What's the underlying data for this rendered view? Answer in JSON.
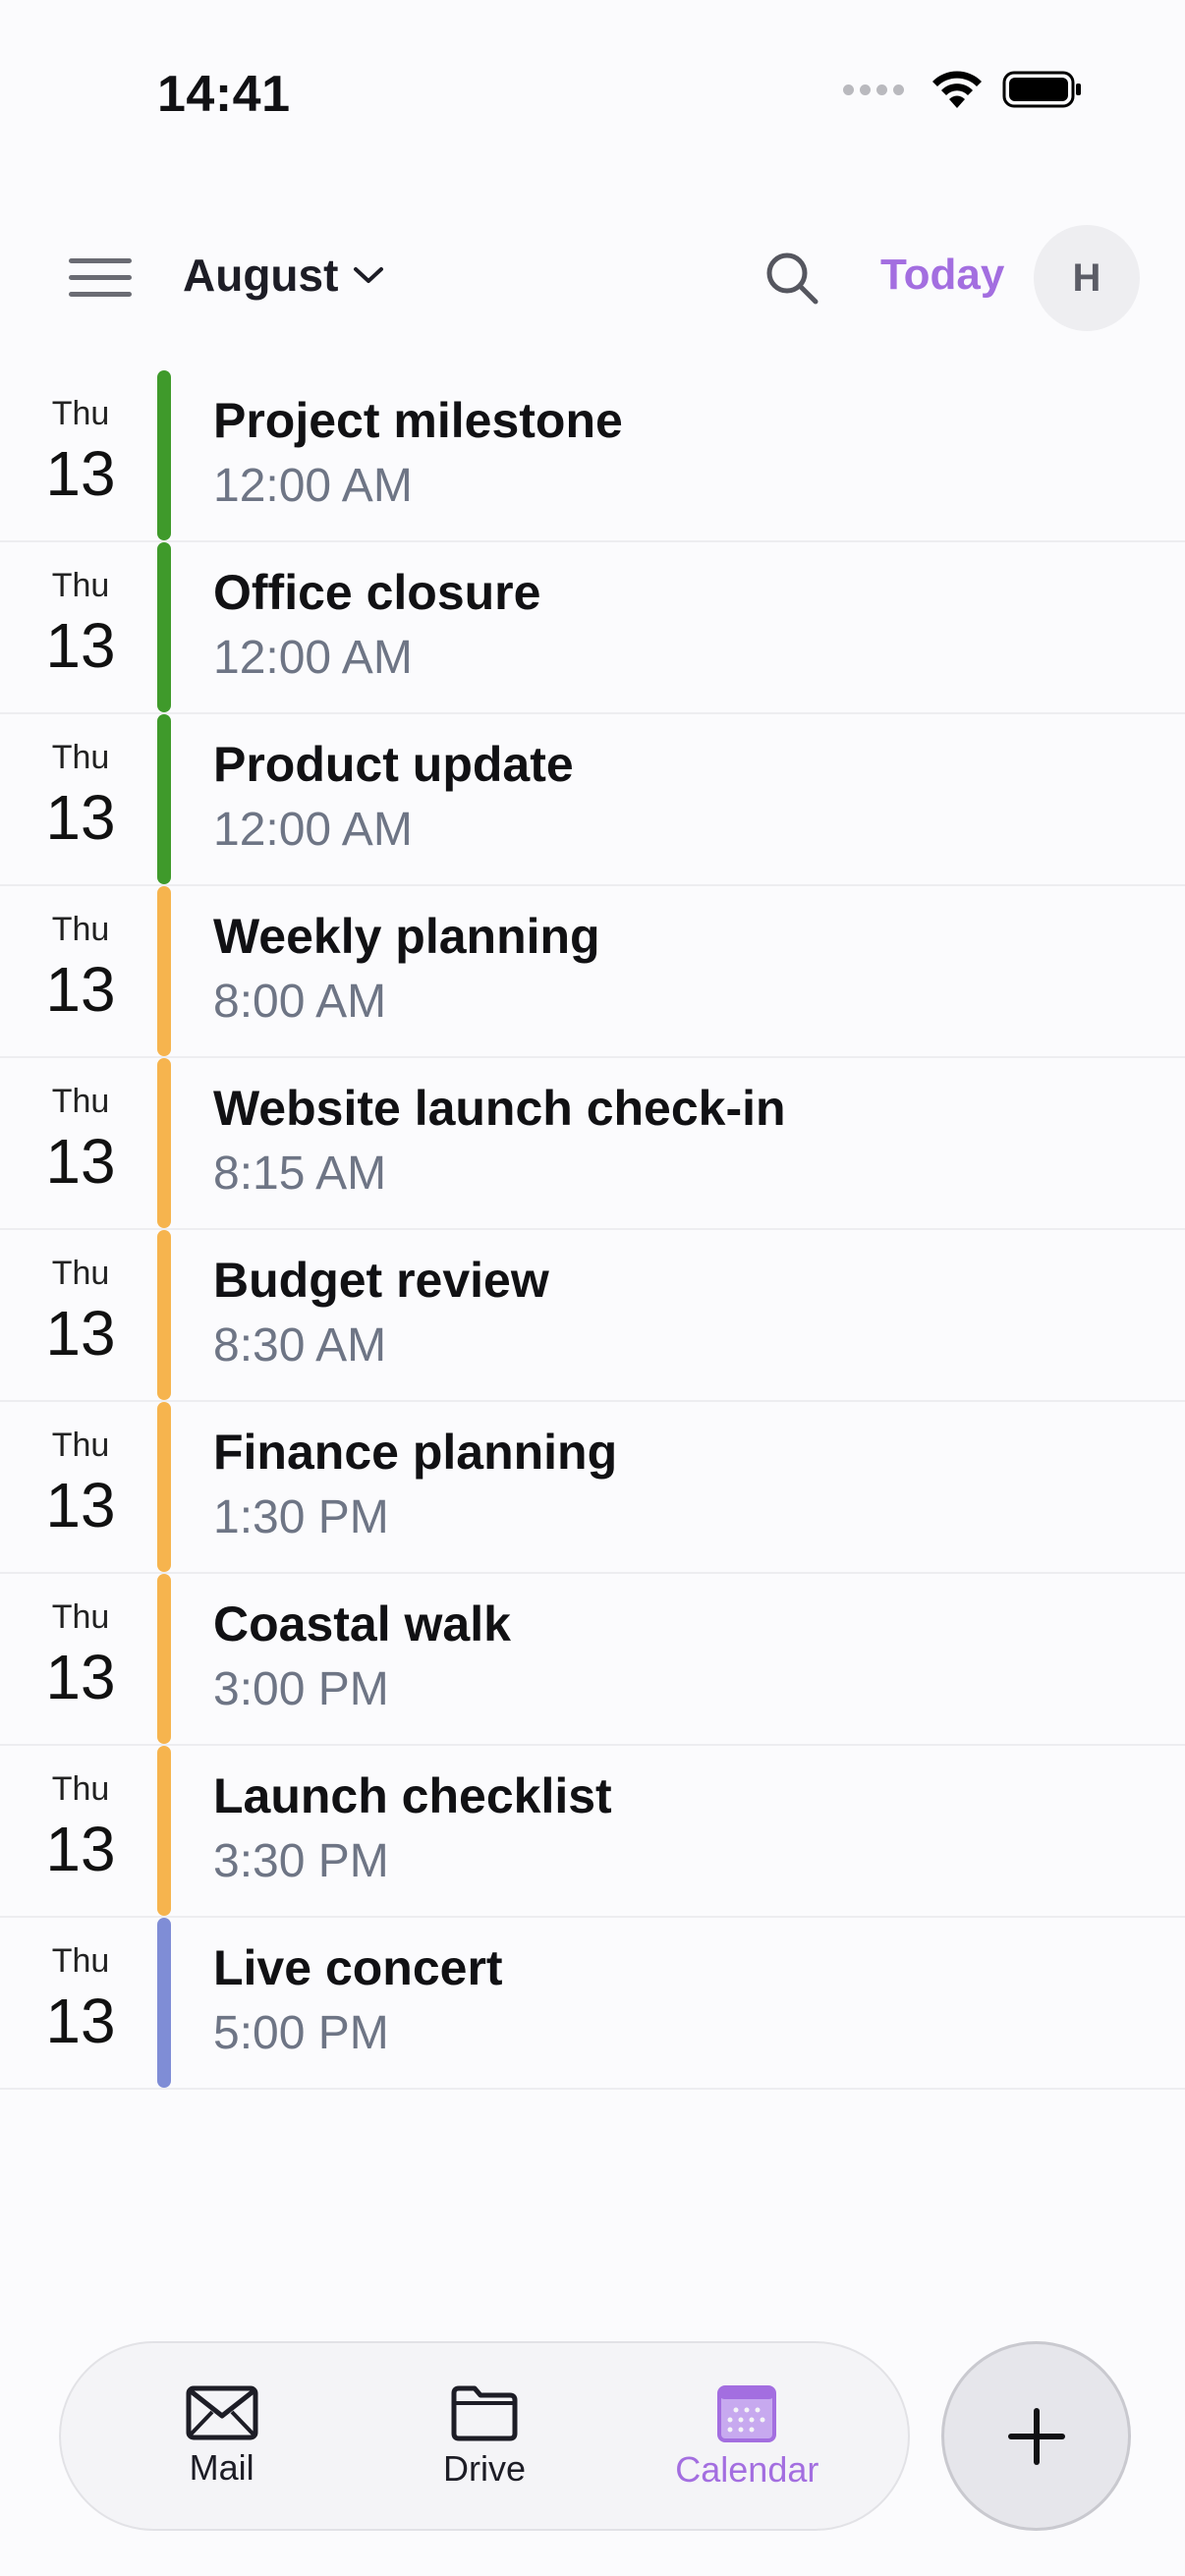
{
  "status_bar": {
    "time": "14:41"
  },
  "header": {
    "month": "August",
    "today_label": "Today",
    "avatar_initial": "H"
  },
  "colors": {
    "green": "#3f9a2b",
    "orange": "#f6b44e",
    "blue": "#7f8dd6",
    "accent": "#a36ee0"
  },
  "events": [
    {
      "dow": "Thu",
      "day": "13",
      "title": "Project milestone",
      "time": "12:00 AM",
      "color": "#3f9a2b"
    },
    {
      "dow": "Thu",
      "day": "13",
      "title": "Office closure",
      "time": "12:00 AM",
      "color": "#3f9a2b"
    },
    {
      "dow": "Thu",
      "day": "13",
      "title": "Product update",
      "time": "12:00 AM",
      "color": "#3f9a2b"
    },
    {
      "dow": "Thu",
      "day": "13",
      "title": "Weekly planning",
      "time": "8:00 AM",
      "color": "#f6b44e"
    },
    {
      "dow": "Thu",
      "day": "13",
      "title": "Website launch check-in",
      "time": "8:15 AM",
      "color": "#f6b44e"
    },
    {
      "dow": "Thu",
      "day": "13",
      "title": "Budget review",
      "time": "8:30 AM",
      "color": "#f6b44e"
    },
    {
      "dow": "Thu",
      "day": "13",
      "title": "Finance planning",
      "time": "1:30 PM",
      "color": "#f6b44e"
    },
    {
      "dow": "Thu",
      "day": "13",
      "title": "Coastal walk",
      "time": "3:00 PM",
      "color": "#f6b44e"
    },
    {
      "dow": "Thu",
      "day": "13",
      "title": "Launch checklist",
      "time": "3:30 PM",
      "color": "#f6b44e"
    },
    {
      "dow": "Thu",
      "day": "13",
      "title": "Live concert",
      "time": "5:00 PM",
      "color": "#7f8dd6"
    }
  ],
  "tabs": [
    {
      "label": "Mail",
      "icon": "mail-icon"
    },
    {
      "label": "Drive",
      "icon": "folder-icon"
    },
    {
      "label": "Calendar",
      "icon": "calendar-icon",
      "active": true
    }
  ]
}
